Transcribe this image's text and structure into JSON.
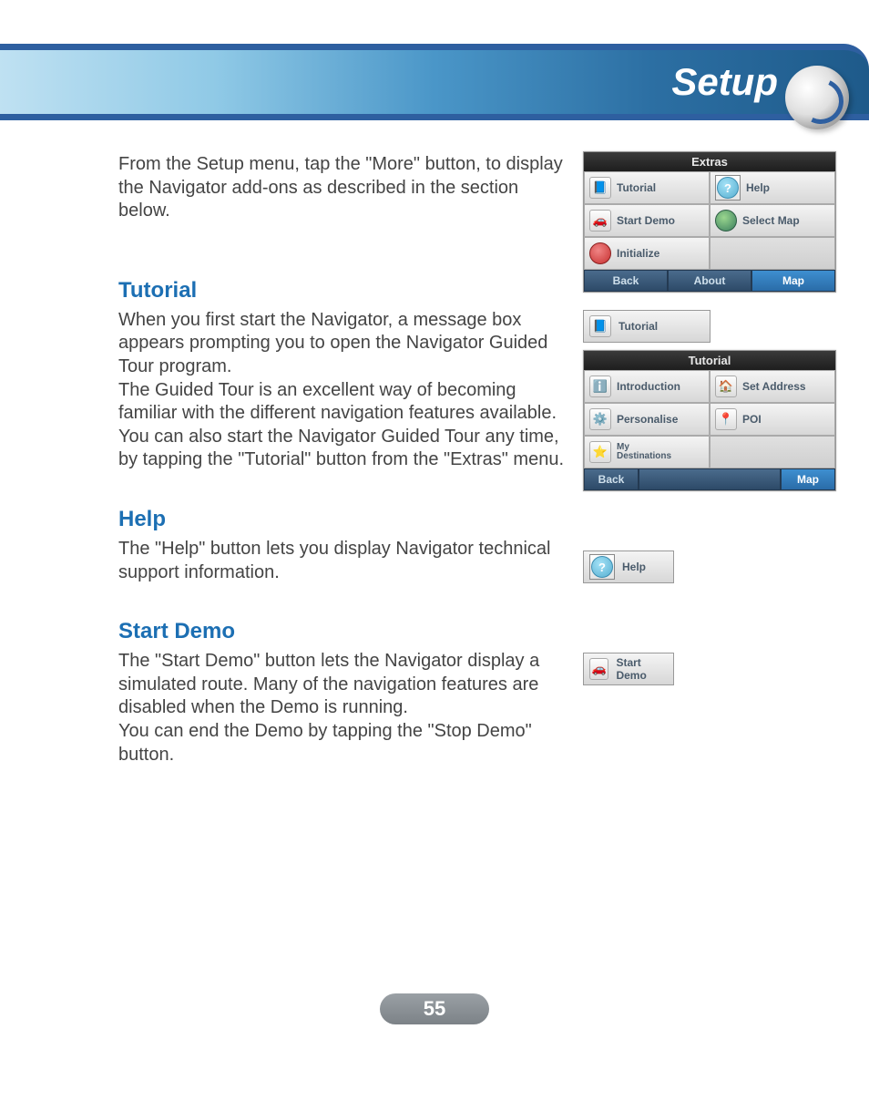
{
  "header": {
    "title": "Setup"
  },
  "intro": "From the Setup menu, tap the \"More\" button, to display the Navigator add-ons as described in the section below.",
  "sections": {
    "tutorial": {
      "heading": "Tutorial",
      "body": "When you first start the Navigator, a message box appears prompting you to open the Navigator Guided Tour program.\nThe Guided Tour is an excellent way of becoming familiar with the different navigation features available. You can also start the Navigator Guided Tour any time, by tapping the \"Tutorial\" button from the \"Extras\" menu."
    },
    "help": {
      "heading": "Help",
      "body": "The \"Help\" button lets you display Navigator technical support information."
    },
    "startdemo": {
      "heading": "Start Demo",
      "body": "The \"Start Demo\" button lets the Navigator display a simulated route. Many of the navigation features are disabled when the Demo is running.\nYou can end the Demo by tapping the \"Stop Demo\" button."
    }
  },
  "extras_panel": {
    "title": "Extras",
    "tiles": [
      "Tutorial",
      "Help",
      "Start Demo",
      "Select Map",
      "Initialize"
    ],
    "bottom": [
      "Back",
      "About",
      "Map"
    ]
  },
  "tutorial_btn": "Tutorial",
  "tutorial_panel": {
    "title": "Tutorial",
    "tiles": [
      "Introduction",
      "Set Address",
      "Personalise",
      "POI",
      "My\nDestinations"
    ],
    "bottom": [
      "Back",
      "Map"
    ]
  },
  "help_btn": "Help",
  "demo_btn": "Start Demo",
  "page_number": "55"
}
